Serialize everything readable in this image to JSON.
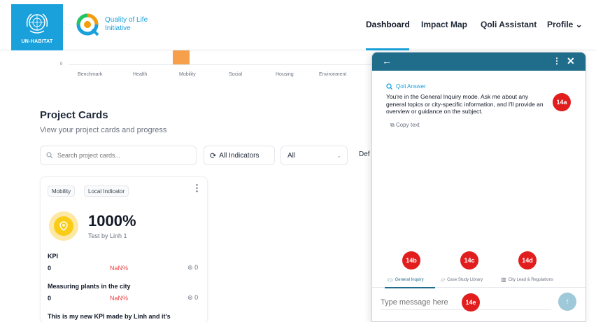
{
  "brand": {
    "un_label": "UN-HABITAT",
    "qoli_line1": "Quality of Life",
    "qoli_line2": "Initiative"
  },
  "nav": {
    "items": [
      "Dashboard",
      "Impact Map",
      "Qoli Assistant",
      "Profile ⌄"
    ],
    "active": "Dashboard"
  },
  "strip": {
    "zero": "0",
    "labels": [
      "Benchmark",
      "Health",
      "Mobility",
      "Social",
      "Housing",
      "Environment"
    ]
  },
  "section": {
    "title": "Project Cards",
    "subtitle": "View your project cards and progress"
  },
  "filters": {
    "search_placeholder": "Search project cards...",
    "indicators_label": "All Indicators",
    "select_value": "All",
    "def_label": "Def"
  },
  "card": {
    "tags": [
      "Mobility",
      "Local Indicator"
    ],
    "percent": "1000%",
    "author": "Test by Linh 1",
    "kpis": [
      {
        "title": "KPI",
        "value": "0",
        "status": "NaN%",
        "count": "0"
      },
      {
        "title": "Measuring plants in the city",
        "value": "0",
        "status": "NaN%",
        "count": "0"
      },
      {
        "title": "This is my new KPI made by Linh and it's",
        "value": "",
        "status": "",
        "count": ""
      }
    ]
  },
  "chat": {
    "answer_label": "Qoli Answer",
    "answer_text": "You're in the General Inquiry mode. Ask me about any general topics or city-specific information, and I'll provide an overview or guidance on the subject.",
    "copy_label": "Copy text",
    "badges": [
      "14a",
      "14b",
      "14c",
      "14d",
      "14e"
    ],
    "modes": [
      "General Inquiry",
      "Case Study Library",
      "City Lead & Regulations"
    ],
    "active_mode": "General Inquiry",
    "input_placeholder": "Type message here",
    "colors": {
      "header": "#1f6d8a",
      "badge": "#e11d1d",
      "accent": "#1aa0db"
    }
  }
}
